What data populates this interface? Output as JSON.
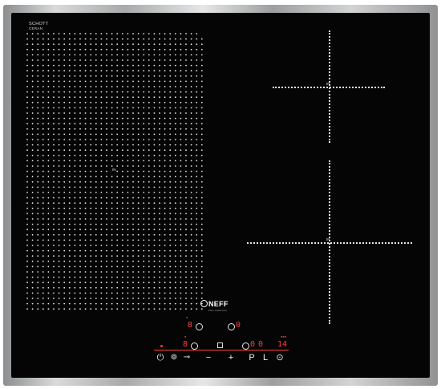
{
  "brand": {
    "line1": "SCHOTT",
    "line2": "CERAN"
  },
  "logo": {
    "text": "NEFF",
    "sub": "Flex Induction"
  },
  "zones": {
    "flex_left": "IN",
    "right_top": "IN",
    "right_bottom": "IN"
  },
  "displays": {
    "zone1_level": "8",
    "zone1_power": "0",
    "zone2_level": "8",
    "zone3_power": "0",
    "zone3_timer": "0",
    "timer_value": "14"
  },
  "controls": {
    "power": "⏻",
    "lock": "⊚",
    "key": "⊸",
    "minus": "−",
    "plus": "+",
    "powerboost": "P",
    "level": "L",
    "timer": "⊙"
  },
  "colors": {
    "glass": "#050505",
    "display": "#ff4038",
    "dots": "#e6e6e6"
  }
}
